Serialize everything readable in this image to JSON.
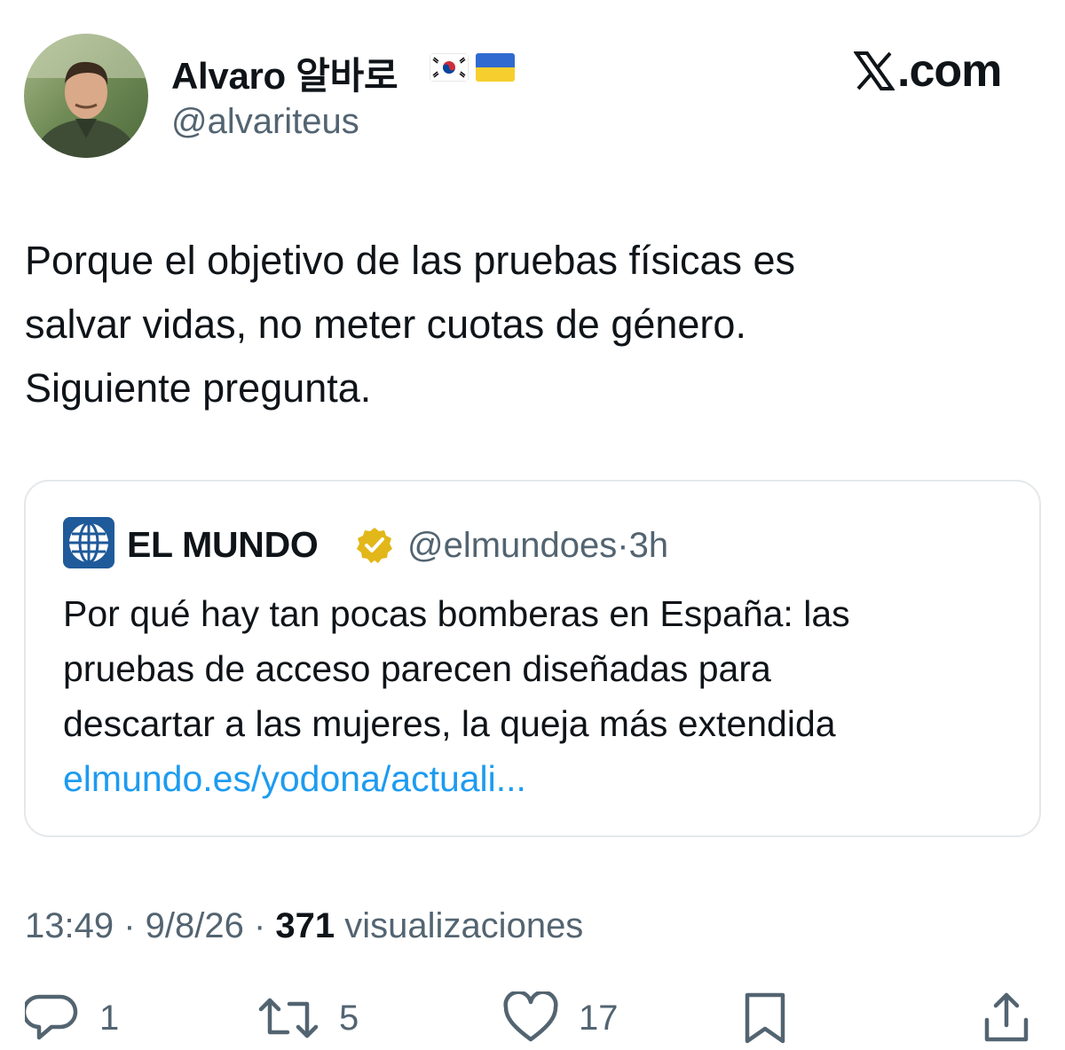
{
  "author": {
    "name": "Alvaro 알바로",
    "handle": "@alvariteus",
    "flags": [
      "south-korea-flag",
      "ukraine-flag"
    ]
  },
  "brand": {
    "suffix": ".com",
    "icon": "x-logo-icon"
  },
  "tweet": {
    "lines": [
      "Porque el objetivo de las pruebas físicas es",
      "salvar vidas, no meter cuotas de género.",
      "Siguiente pregunta."
    ]
  },
  "quoted": {
    "name": "EL MUNDO",
    "handle": "@elmundoes",
    "separator": "·",
    "time": "3h",
    "logo_icon": "el-mundo-globe-logo",
    "verified_icon": "verified-badge-icon",
    "lines": [
      "Por qué hay tan pocas bomberas en España: las",
      "pruebas de acceso parecen diseñadas para",
      "descartar a las mujeres, la queja más extendida"
    ],
    "link": "elmundo.es/yodona/actuali..."
  },
  "meta": {
    "time": "13:49",
    "sep1": " · ",
    "date": "9/8/26",
    "sep2": " · ",
    "views_count": "371",
    "views_label": " visualizaciones"
  },
  "actions": {
    "reply_count": "1",
    "retweet_count": "5",
    "like_count": "17"
  },
  "colors": {
    "text": "#0f1419",
    "secondary": "#536471",
    "link": "#1d9bf0",
    "border": "#e4e8eb",
    "verified_gold": "#e2b719",
    "el_mundo_blue": "#1f5a9a"
  }
}
